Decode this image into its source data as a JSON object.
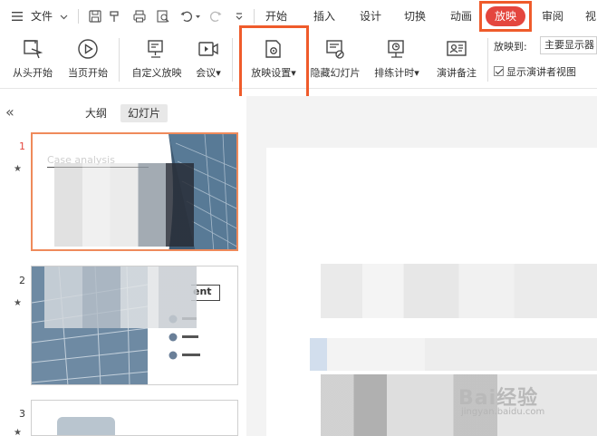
{
  "menubar": {
    "menu_label": "文件",
    "tabs": [
      "开始",
      "插入",
      "设计",
      "切换",
      "动画",
      "放映",
      "审阅",
      "视"
    ],
    "active_tab": "放映"
  },
  "ribbon": {
    "buttons": [
      "从头开始",
      "当页开始",
      "自定义放映",
      "会议",
      "放映设置",
      "隐藏幻灯片",
      "排练计时",
      "演讲备注"
    ],
    "play_to_label": "放映到:",
    "play_to_value": "主要显示器",
    "presenter_view_label": "显示演讲者视图",
    "presenter_view_checked": true
  },
  "leftpane": {
    "tabs": [
      "大纲",
      "幻灯片"
    ],
    "active_tab": "幻灯片",
    "slides": [
      {
        "number": "1",
        "title_text": "Case analysis"
      },
      {
        "number": "2",
        "heading_text": "ent"
      },
      {
        "number": "3"
      }
    ]
  },
  "watermark": {
    "brand": "Bai经验",
    "url": "jingyan.baidu.com"
  },
  "colors": {
    "accent": "#e4463e",
    "highlight_box": "#ef5b2b"
  }
}
